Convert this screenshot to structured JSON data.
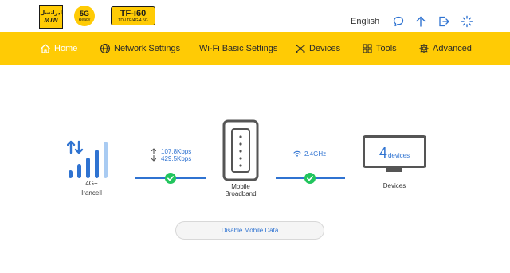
{
  "header": {
    "logo_mtn_fa": "ایرانسل",
    "logo_mtn_en": "MTN",
    "logo_5g_big": "5G",
    "logo_5g_small": "Ready",
    "logo_model_name": "TF-i60",
    "logo_model_tech": "TD-LTE/4G/4.5G",
    "language": "English",
    "icons": [
      "chat-icon",
      "upload-icon",
      "logout-icon",
      "loading-icon"
    ]
  },
  "nav": {
    "items": [
      {
        "label": "Home",
        "icon": "home-icon"
      },
      {
        "label": "Network Settings",
        "icon": "globe-icon"
      },
      {
        "label": "Wi-Fi Basic Settings",
        "icon": ""
      },
      {
        "label": "Devices",
        "icon": "devices-icon"
      },
      {
        "label": "Tools",
        "icon": "tools-icon"
      },
      {
        "label": "Advanced",
        "icon": "gear-icon"
      }
    ]
  },
  "status": {
    "network_type": "4G+",
    "operator": "Irancell",
    "upload_speed": "107.8Kbps",
    "download_speed": "429.5Kbps",
    "router_label_line1": "Mobile",
    "router_label_line2": "Broadband",
    "wifi_band": "2.4GHz",
    "devices_count": "4",
    "devices_unit": "devices",
    "devices_label": "Devices",
    "signal_bars_active": 4,
    "signal_bars_total": 5
  },
  "actions": {
    "disable_mobile_data": "Disable Mobile Data"
  },
  "colors": {
    "brand_yellow": "#ffcb05",
    "accent_blue": "#2f73d1",
    "success_green": "#22c55e",
    "device_gray": "#555555"
  }
}
